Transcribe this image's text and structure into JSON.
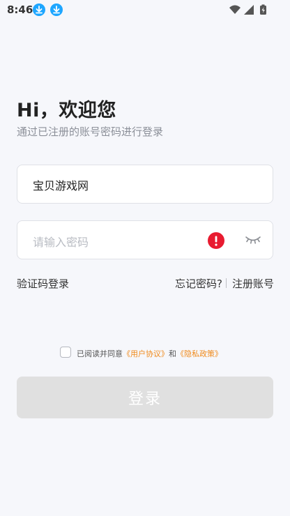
{
  "status_bar": {
    "time": "8:46",
    "icons": [
      "download-icon",
      "download-icon",
      "wifi-icon",
      "signal-icon",
      "battery-icon"
    ]
  },
  "header": {
    "title": "Hi，欢迎您",
    "subtitle": "通过已注册的账号密码进行登录"
  },
  "form": {
    "account_value": "宝贝游戏网",
    "password_placeholder": "请输入密码",
    "password_value": "",
    "error_icon": "error-icon",
    "toggle_icon": "eye-closed-icon"
  },
  "links": {
    "sms_login": "验证码登录",
    "forgot_password": "忘记密码?",
    "register": "注册账号"
  },
  "agreement": {
    "checked": false,
    "prefix": "已阅读并同意",
    "user_agreement": "《用户协议》",
    "conjunction": "和",
    "privacy_policy": "《隐私政策》"
  },
  "login_button": {
    "label": "登录",
    "enabled": false
  },
  "colors": {
    "accent_link": "#f08a1c",
    "error": "#e81b30",
    "download_badge": "#1ea6ff",
    "button_disabled": "#e0e0e0",
    "background": "#f6f7fb"
  }
}
